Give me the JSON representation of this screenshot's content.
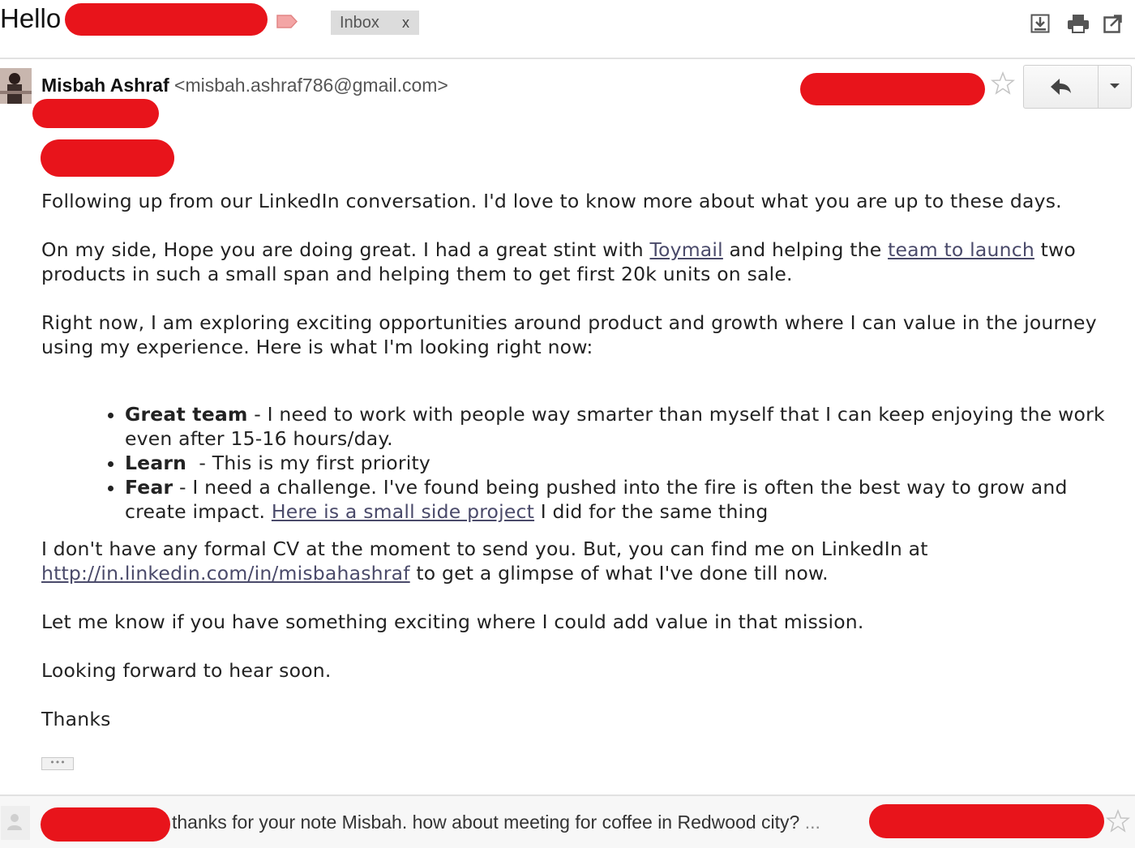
{
  "header": {
    "subject": "Hello",
    "inbox_label": "Inbox",
    "inbox_close": "x",
    "icons": [
      "download-icon",
      "print-icon",
      "new-window-icon"
    ]
  },
  "message": {
    "sender_name": "Misbah Ashraf",
    "sender_email": "<misbah.ashraf786@gmail.com>",
    "body": {
      "p1": "Following up from our LinkedIn conversation. I'd love to know more about what you are up to these days.",
      "p2_a": "On my side, Hope you are doing great. I had a great stint with ",
      "p2_link1": "Toymail",
      "p2_b": " and helping the ",
      "p2_link2": "team to launch",
      "p2_c": " two products in such a small span and helping them to get first 20k units on sale.",
      "p3": "Right now, I am exploring exciting opportunities around product and growth where I can value in the journey using my experience. Here is what I'm looking right now:",
      "bullets": [
        {
          "title": "Great team",
          "text": " - I need to work with people way smarter than myself that I can keep enjoying the work even after 15-16 hours/day."
        },
        {
          "title": "Learn",
          "text": "  - This is my first priority"
        },
        {
          "title": "Fear",
          "text": " - I need a challenge. I've found being pushed into the fire is often the best way to grow and create impact. ",
          "link": "Here is a small side project",
          "after": " I did for the same thing"
        }
      ],
      "p4_a": "I don't have any formal CV at the moment to send you. But, you can find me on LinkedIn at ",
      "p4_link": "http://in.linkedin.com/in/misbahashraf",
      "p4_b": " to get a glimpse of what I've done till now.",
      "p5": "Let me know if you have something exciting where I could add value in that mission.",
      "p6": "Looking forward to hear soon.",
      "p7": "Thanks",
      "trimmed": "•••"
    }
  },
  "reply_preview": {
    "snippet": "thanks for your note Misbah. how about meeting for coffee in Redwood city?",
    "ellipsis": " ..."
  },
  "colors": {
    "redaction": "#e8141b",
    "link": "#4a4a6a",
    "label_tag": "#f19a9a"
  }
}
